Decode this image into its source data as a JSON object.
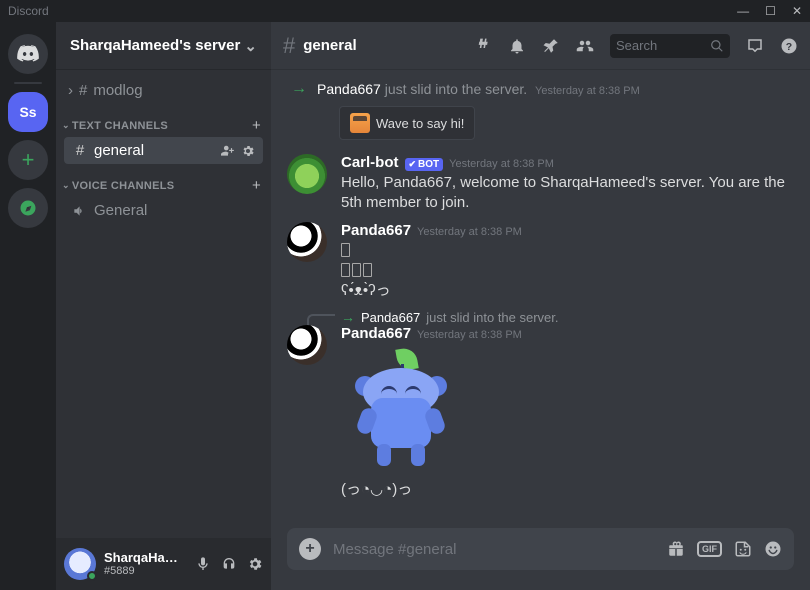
{
  "app": {
    "title": "Discord"
  },
  "window_controls": {
    "minimize": "—",
    "maximize": "☐",
    "close": "✕"
  },
  "guilds": {
    "home_label": "Home",
    "selected_initials": "Ss",
    "add_label": "+",
    "explore_label": "Explore"
  },
  "server": {
    "name": "SharqaHameed's server",
    "unlisted_channel": "modlog",
    "categories": [
      {
        "label": "TEXT CHANNELS",
        "channels": [
          {
            "name": "general",
            "type": "text",
            "active": "true"
          }
        ]
      },
      {
        "label": "VOICE CHANNELS",
        "channels": [
          {
            "name": "General",
            "type": "voice",
            "active": "false"
          }
        ]
      }
    ]
  },
  "user_panel": {
    "username": "SharqaHam...",
    "tag": "#5889"
  },
  "chat_header": {
    "channel": "general",
    "search_placeholder": "Search"
  },
  "messages": {
    "join1_user": "Panda667",
    "join1_text": " just slid into the server.",
    "join1_time": "Yesterday at 8:38 PM",
    "wave_label": "Wave to say hi!",
    "carl": {
      "name": "Carl-bot",
      "bot_tag": "BOT",
      "time": "Yesterday at 8:38 PM",
      "text": "Hello, Panda667, welcome to SharqaHameed's server. You are the 5th member to join."
    },
    "panda1": {
      "name": "Panda667",
      "time": "Yesterday at 8:38 PM",
      "line3": "ʕ•́ᴥ•̀ʔっ"
    },
    "reply_ref": {
      "user": "Panda667",
      "text": " just slid into the server."
    },
    "panda2": {
      "name": "Panda667",
      "time": "Yesterday at 8:38 PM",
      "line1": "(っ◔◡◔)っ"
    }
  },
  "composer": {
    "placeholder": "Message #general"
  }
}
